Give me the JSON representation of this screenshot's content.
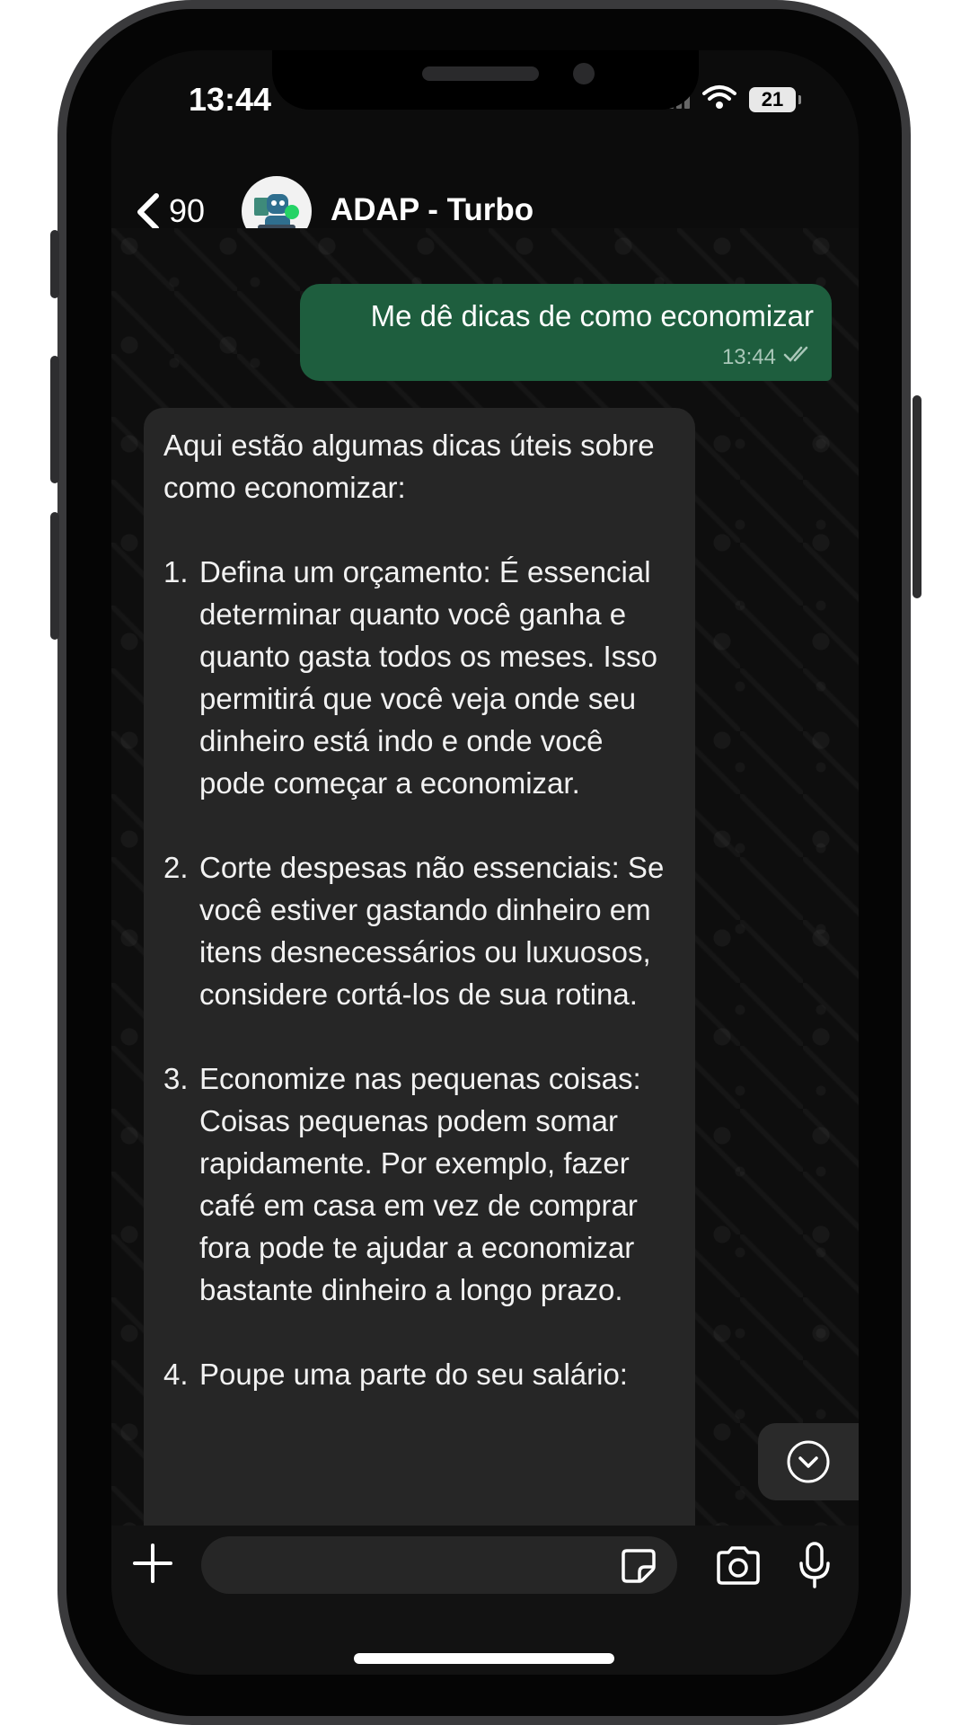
{
  "status_bar": {
    "time": "13:44",
    "battery": "21"
  },
  "header": {
    "back_count": "90",
    "contact_name": "ADAP - Turbo"
  },
  "messages": {
    "outgoing": {
      "text": "Me dê dicas de como economizar",
      "time": "13:44"
    },
    "incoming": {
      "intro": "Aqui estão algumas dicas úteis sobre como economizar:",
      "tips": [
        {
          "number": "1.",
          "text": "Defina um orçamento: É essencial determinar quanto você ganha e quanto gasta todos os meses. Isso permitirá que você veja onde seu dinheiro está indo e onde você pode começar a economizar."
        },
        {
          "number": "2.",
          "text": "Corte despesas não essenciais: Se você estiver gastando dinheiro em itens desnecessários ou luxuosos, considere cortá-los de sua rotina."
        },
        {
          "number": "3.",
          "text": "Economize nas pequenas coisas: Coisas pequenas podem somar rapidamente. Por exemplo, fazer café em casa em vez de comprar fora pode te ajudar a economizar bastante dinheiro a longo prazo."
        },
        {
          "number": "4.",
          "text": "Poupe uma parte do seu salário:"
        }
      ]
    }
  },
  "input": {
    "value": ""
  },
  "colors": {
    "outgoing_bubble": "#1e5e3e",
    "incoming_bubble": "#262626",
    "background": "#0e0e0e"
  }
}
